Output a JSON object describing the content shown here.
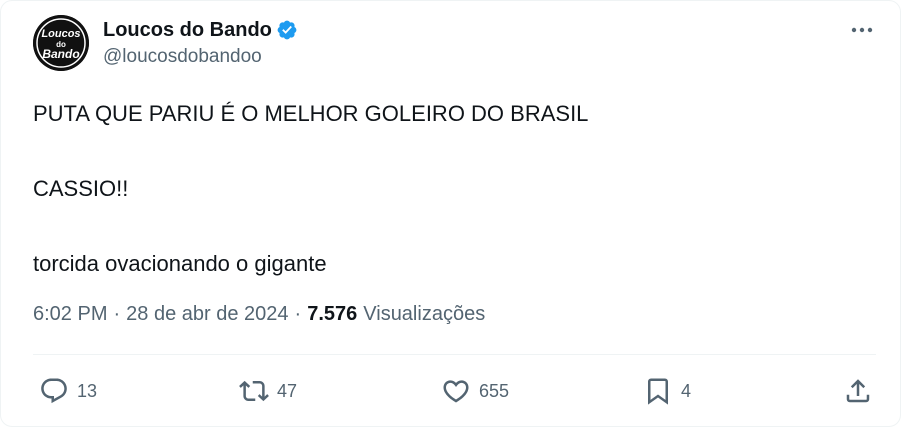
{
  "author": {
    "display_name": "Loucos do Bando",
    "handle": "@loucosdobandoo",
    "avatar_text_top": "Loucos",
    "avatar_text_mid": "do",
    "avatar_text_bottom": "Bando",
    "verified": true
  },
  "tweet": {
    "lines": [
      "PUTA QUE PARIU É O MELHOR GOLEIRO DO BRASIL",
      "CASSIO!!",
      "torcida ovacionando o gigante"
    ],
    "time": "6:02 PM",
    "separator": "·",
    "date": "28 de abr de 2024",
    "views_count": "7.576",
    "views_label": "Visualizações"
  },
  "actions": {
    "replies": "13",
    "retweets": "47",
    "likes": "655",
    "bookmarks": "4"
  },
  "icons": {
    "more": "more-horizontal-icon",
    "reply": "reply-icon",
    "retweet": "retweet-icon",
    "like": "heart-icon",
    "bookmark": "bookmark-icon",
    "share": "share-icon",
    "verified": "verified-badge-icon"
  },
  "colors": {
    "primary_text": "#0f1419",
    "secondary_text": "#536471",
    "verified_blue": "#1d9bf0"
  }
}
